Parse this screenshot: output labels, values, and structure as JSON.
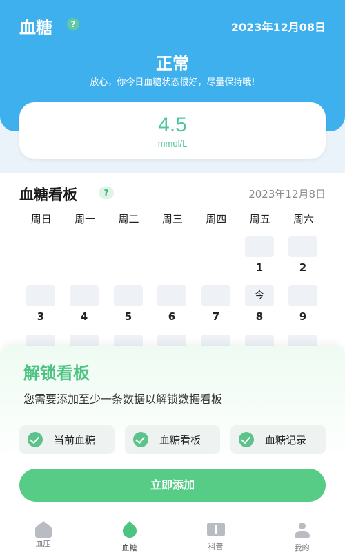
{
  "header": {
    "title": "血糖",
    "help_glyph": "?",
    "date": "2023年12月08日",
    "status": "正常",
    "status_message": "放心，你今日血糖状态很好，尽量保持哦!"
  },
  "reading": {
    "value": "4.5",
    "unit": "mmol/L"
  },
  "board": {
    "title": "血糖看板",
    "help_glyph": "?",
    "date": "2023年12月8日",
    "weekdays": [
      "周日",
      "周一",
      "周二",
      "周三",
      "周四",
      "周五",
      "周六"
    ],
    "week1": [
      {
        "day": "1",
        "box_text": ""
      },
      {
        "day": "2",
        "box_text": ""
      }
    ],
    "week2": [
      {
        "day": "3",
        "box_text": ""
      },
      {
        "day": "4",
        "box_text": ""
      },
      {
        "day": "5",
        "box_text": ""
      },
      {
        "day": "6",
        "box_text": ""
      },
      {
        "day": "7",
        "box_text": ""
      },
      {
        "day": "8",
        "box_text": "今"
      },
      {
        "day": "9",
        "box_text": ""
      }
    ]
  },
  "unlock": {
    "title": "解锁看板",
    "description": "您需要添加至少一条数据以解锁数据看板",
    "features": [
      "当前血糖",
      "血糖看板",
      "血糖记录"
    ],
    "button": "立即添加"
  },
  "nav": {
    "items": [
      {
        "label": "血压",
        "icon": "house-icon"
      },
      {
        "label": "血糖",
        "icon": "drop-icon"
      },
      {
        "label": "科普",
        "icon": "book-icon"
      },
      {
        "label": "我的",
        "icon": "user-icon"
      }
    ],
    "active_index": 1
  },
  "colors": {
    "header": "#3fb0ee",
    "accent_green": "#56cc86",
    "value_green": "#4fc69a"
  }
}
